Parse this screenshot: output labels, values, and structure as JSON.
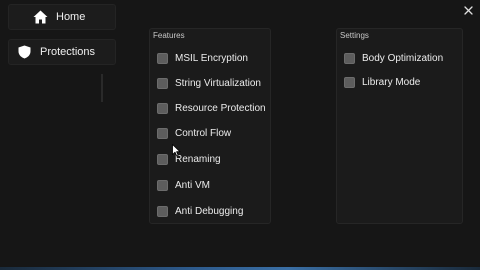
{
  "nav": {
    "home_label": "Home",
    "protections_label": "Protections"
  },
  "features": {
    "title": "Features",
    "options": [
      {
        "label": "MSIL Encryption",
        "checked": false
      },
      {
        "label": "String Virtualization",
        "checked": false
      },
      {
        "label": "Resource Protection",
        "checked": false
      },
      {
        "label": "Control Flow",
        "checked": false
      },
      {
        "label": "Renaming",
        "checked": false
      },
      {
        "label": "Anti VM",
        "checked": false
      },
      {
        "label": "Anti Debugging",
        "checked": false
      }
    ]
  },
  "settings": {
    "title": "Settings",
    "options": [
      {
        "label": "Body Optimization",
        "checked": false
      },
      {
        "label": "Library Mode",
        "checked": false
      }
    ]
  },
  "icons": {
    "home": "home-icon",
    "protections": "shield-icon",
    "close": "close-icon"
  },
  "colors": {
    "background": "#161616",
    "panel": "#1b1b1b",
    "checkbox": "#5d5d5d",
    "accent": "#2d5a8c"
  }
}
